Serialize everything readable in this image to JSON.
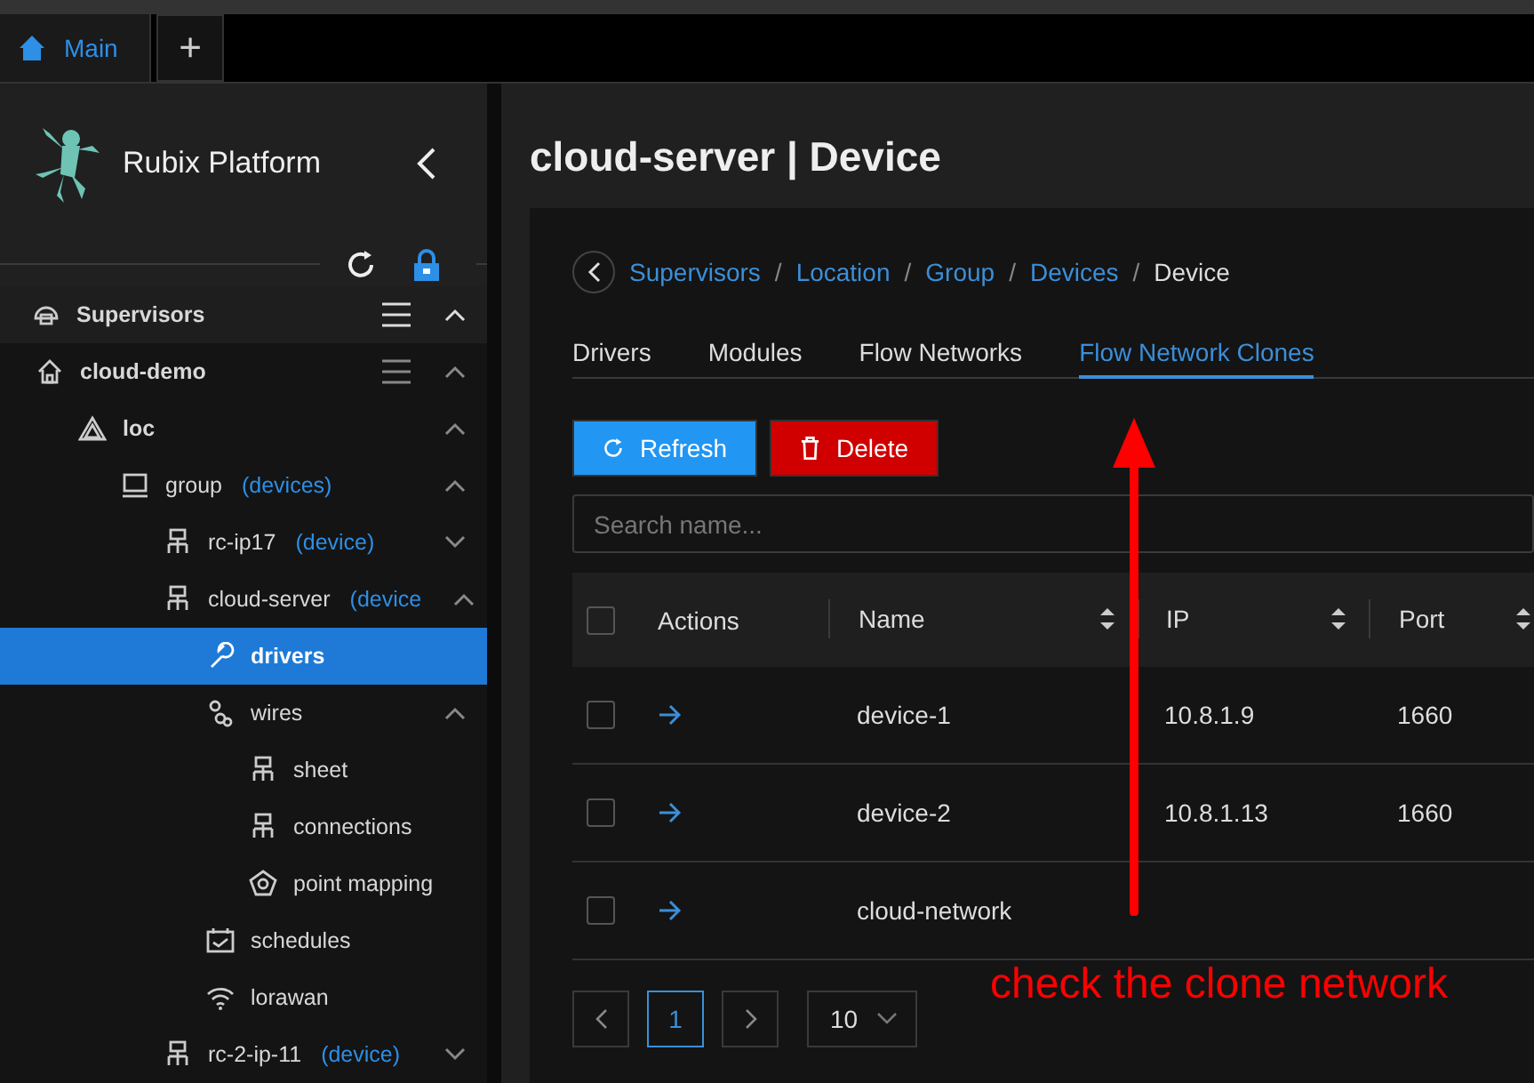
{
  "app_tabs": [
    {
      "kind": "home",
      "label": "Main",
      "selected": true
    },
    {
      "kind": "add",
      "label": "+",
      "selected": false
    }
  ],
  "sidebar": {
    "title": "Rubix Platform",
    "header": {
      "label": "Supervisors"
    },
    "tree": [
      {
        "kind": "host",
        "label": "cloud-demo",
        "expanded": true,
        "menu": true,
        "children": [
          {
            "kind": "location",
            "label": "loc",
            "expanded": true,
            "children": [
              {
                "kind": "group",
                "label": "group",
                "tag": "(devices)",
                "expanded": true,
                "children": [
                  {
                    "kind": "device",
                    "label": "rc-ip17",
                    "tag": "(device)",
                    "expanded": false
                  },
                  {
                    "kind": "device",
                    "label": "cloud-server",
                    "tag": "(device",
                    "expanded": true,
                    "children": [
                      {
                        "kind": "driver",
                        "label": "drivers",
                        "selected": true
                      },
                      {
                        "kind": "wires",
                        "label": "wires",
                        "expanded": true,
                        "children": [
                          {
                            "kind": "device",
                            "label": "sheet"
                          },
                          {
                            "kind": "device",
                            "label": "connections"
                          },
                          {
                            "kind": "mapping",
                            "label": "point mapping"
                          }
                        ]
                      },
                      {
                        "kind": "schedule",
                        "label": "schedules"
                      },
                      {
                        "kind": "wireless",
                        "label": "lorawan"
                      }
                    ]
                  },
                  {
                    "kind": "device",
                    "label": "rc-2-ip-11",
                    "tag": "(device)",
                    "expanded": false
                  }
                ]
              }
            ]
          }
        ]
      }
    ]
  },
  "page": {
    "title": "cloud-server | Device",
    "breadcrumb": [
      {
        "label": "Supervisors",
        "link": true
      },
      {
        "separator": "/",
        "label": "Location",
        "link": true
      },
      {
        "separator": "/",
        "label": "Group",
        "link": true
      },
      {
        "separator": "/",
        "label": "Devices",
        "link": true
      },
      {
        "separator": "/",
        "label": "Device",
        "link": false
      }
    ],
    "tabs": [
      {
        "label": "Drivers",
        "selected": false
      },
      {
        "label": "Modules",
        "selected": false
      },
      {
        "label": "Flow Networks",
        "selected": false
      },
      {
        "label": "Flow Network Clones",
        "selected": true
      }
    ],
    "buttons": [
      {
        "kind": "refresh",
        "label": "Refresh"
      },
      {
        "kind": "delete",
        "label": "Delete"
      }
    ],
    "search": {
      "placeholder": "Search name..."
    },
    "table": {
      "header_checked": false,
      "columns": [
        {
          "label": "Actions",
          "sortable": false
        },
        {
          "label": "Name",
          "sortable": true
        },
        {
          "label": "IP",
          "sortable": true
        },
        {
          "label": "Port",
          "sortable": true
        }
      ],
      "rows": [
        {
          "checked": false,
          "name": "device-1",
          "ip": "10.8.1.9",
          "port": "1660"
        },
        {
          "checked": false,
          "name": "device-2",
          "ip": "10.8.1.13",
          "port": "1660"
        },
        {
          "checked": false,
          "name": "cloud-network"
        }
      ]
    },
    "pagination": {
      "pages": [
        {
          "label": "1",
          "selected": true
        }
      ],
      "page_size": "10"
    },
    "annotation": {
      "text": "check the clone network"
    }
  }
}
